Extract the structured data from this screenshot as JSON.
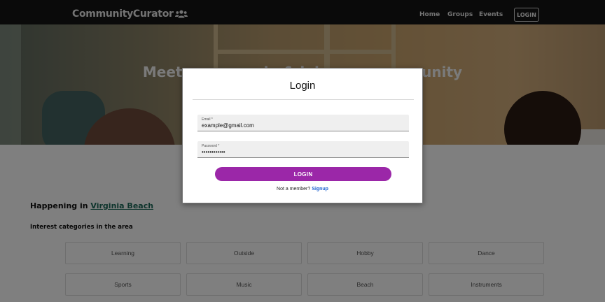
{
  "navbar": {
    "brand": "CommunityCurator",
    "links": [
      "Home",
      "Groups",
      "Events"
    ],
    "login_label": "LOGIN"
  },
  "hero": {
    "title": "Meet new people & join your community"
  },
  "content": {
    "happening_prefix": "Happening in",
    "location": "Virginia Beach",
    "interest_title": "Interest categories in the area",
    "categories": [
      "Learning",
      "Outside",
      "Hobby",
      "Dance",
      "Sports",
      "Music",
      "Beach",
      "Instruments"
    ]
  },
  "modal": {
    "title": "Login",
    "email_label": "Email *",
    "email_value": "example@gmail.com",
    "password_label": "Password *",
    "password_value": "••••••••••••",
    "login_button": "LOGIN",
    "not_member": "Not a member?",
    "signup": "Signup"
  },
  "colors": {
    "accent": "#9b27a8",
    "link": "#1e62d0",
    "location_link": "#1d6b5a",
    "navbar": "#141414"
  },
  "icons": {
    "brand_icon": "users-icon"
  }
}
